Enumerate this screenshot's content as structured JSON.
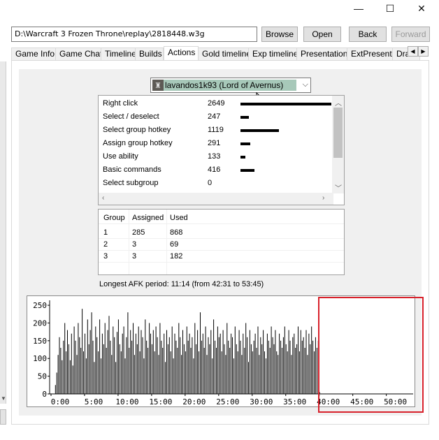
{
  "window_controls": {
    "minimize": "—",
    "maximize": "☐",
    "close": "✕"
  },
  "toolbar": {
    "path": "D:\\Warcraft 3 Frozen Throne\\replay\\2818448.w3g",
    "browse_label": "Browse",
    "open_label": "Open",
    "back_label": "Back",
    "forward_label": "Forward"
  },
  "tabs": [
    {
      "label": "Game Info"
    },
    {
      "label": "Game Chat"
    },
    {
      "label": "Timeline"
    },
    {
      "label": "Builds"
    },
    {
      "label": "Actions",
      "active": true
    },
    {
      "label": "Gold timeline"
    },
    {
      "label": "Exp timeline"
    },
    {
      "label": "Presentation"
    },
    {
      "label": "ExtPresent"
    },
    {
      "label": "Dra"
    }
  ],
  "player_select": {
    "value": "lavandos1k93 (Lord of Avernus)"
  },
  "actions": {
    "rows": [
      {
        "name": "Right click",
        "count": 2649
      },
      {
        "name": "Select / deselect",
        "count": 247
      },
      {
        "name": "Select group hotkey",
        "count": 1119
      },
      {
        "name": "Assign group hotkey",
        "count": 291
      },
      {
        "name": "Use ability",
        "count": 133
      },
      {
        "name": "Basic commands",
        "count": 416
      },
      {
        "name": "Select subgroup",
        "count": 0
      }
    ]
  },
  "groups": {
    "headers": [
      "Group",
      "Assigned",
      "Used"
    ],
    "rows": [
      [
        "1",
        "285",
        "868"
      ],
      [
        "2",
        "3",
        "69"
      ],
      [
        "3",
        "3",
        "182"
      ]
    ]
  },
  "afk": {
    "text": "Longest AFK period: 11:14 (from 42:31 to 53:45)"
  },
  "chart_data": {
    "type": "bar",
    "title": "",
    "xlabel": "",
    "ylabel": "",
    "ylim": [
      0,
      260
    ],
    "yticks": [
      0,
      50,
      100,
      150,
      200,
      250
    ],
    "xticks": [
      "0:00",
      "5:00",
      "10:00",
      "15:00",
      "20:00",
      "25:00",
      "30:00",
      "35:00",
      "40:00",
      "45:00",
      "50:00"
    ],
    "xlim_minutes": [
      0,
      54
    ],
    "bar_color": "#000000",
    "x_minutes": [
      0.0,
      0.2,
      0.4,
      0.6,
      0.8,
      1.0,
      1.2,
      1.4,
      1.6,
      1.8,
      2.0,
      2.2,
      2.4,
      2.6,
      2.8,
      3.0,
      3.2,
      3.4,
      3.6,
      3.8,
      4.0,
      4.2,
      4.4,
      4.6,
      4.8,
      5.0,
      5.2,
      5.4,
      5.6,
      5.8,
      6.0,
      6.2,
      6.4,
      6.6,
      6.8,
      7.0,
      7.2,
      7.4,
      7.6,
      7.8,
      8.0,
      8.2,
      8.4,
      8.6,
      8.8,
      9.0,
      9.2,
      9.4,
      9.6,
      9.8,
      10.0,
      10.2,
      10.4,
      10.6,
      10.8,
      11.0,
      11.2,
      11.4,
      11.6,
      11.8,
      12.0,
      12.2,
      12.4,
      12.6,
      12.8,
      13.0,
      13.2,
      13.4,
      13.6,
      13.8,
      14.0,
      14.2,
      14.4,
      14.6,
      14.8,
      15.0,
      15.2,
      15.4,
      15.6,
      15.8,
      16.0,
      16.2,
      16.4,
      16.6,
      16.8,
      17.0,
      17.2,
      17.4,
      17.6,
      17.8,
      18.0,
      18.2,
      18.4,
      18.6,
      18.8,
      19.0,
      19.2,
      19.4,
      19.6,
      19.8,
      20.0,
      20.2,
      20.4,
      20.6,
      20.8,
      21.0,
      21.2,
      21.4,
      21.6,
      21.8,
      22.0,
      22.2,
      22.4,
      22.6,
      22.8,
      23.0,
      23.2,
      23.4,
      23.6,
      23.8,
      24.0,
      24.2,
      24.4,
      24.6,
      24.8,
      25.0,
      25.2,
      25.4,
      25.6,
      25.8,
      26.0,
      26.2,
      26.4,
      26.6,
      26.8,
      27.0,
      27.2,
      27.4,
      27.6,
      27.8,
      28.0,
      28.2,
      28.4,
      28.6,
      28.8,
      29.0,
      29.2,
      29.4,
      29.6,
      29.8,
      30.0,
      30.2,
      30.4,
      30.6,
      30.8,
      31.0,
      31.2,
      31.4,
      31.6,
      31.8,
      32.0,
      32.2,
      32.4,
      32.6,
      32.8,
      33.0,
      33.2,
      33.4,
      33.6,
      33.8,
      34.0,
      34.2,
      34.4,
      34.6,
      34.8,
      35.0,
      35.2,
      35.4,
      35.6,
      35.8,
      36.0,
      36.2,
      36.4,
      36.6,
      36.8,
      37.0,
      37.2,
      37.4,
      37.6,
      37.8,
      38.0,
      38.2,
      38.4,
      38.6,
      38.8,
      39.0,
      39.2,
      39.4,
      39.6,
      39.8,
      40.0,
      40.2,
      40.4,
      40.6,
      40.8,
      41.0,
      41.2,
      41.4,
      41.6,
      41.8,
      42.0,
      42.2,
      42.4,
      43.0
    ],
    "values": [
      0,
      0,
      0,
      25,
      60,
      110,
      160,
      130,
      95,
      150,
      200,
      120,
      180,
      140,
      95,
      170,
      80,
      190,
      150,
      110,
      200,
      160,
      130,
      240,
      120,
      170,
      100,
      210,
      140,
      180,
      230,
      150,
      90,
      190,
      160,
      120,
      210,
      100,
      170,
      140,
      200,
      130,
      180,
      220,
      150,
      110,
      190,
      160,
      90,
      175,
      210,
      140,
      120,
      170,
      190,
      100,
      160,
      230,
      130,
      180,
      150,
      200,
      110,
      170,
      140,
      190,
      120,
      180,
      160,
      100,
      210,
      150,
      130,
      200,
      170,
      140,
      180,
      120,
      190,
      160,
      110,
      200,
      150,
      130,
      170,
      90,
      180,
      140,
      160,
      120,
      190,
      100,
      170,
      150,
      130,
      200,
      160,
      110,
      180,
      140,
      120,
      190,
      150,
      170,
      130,
      160,
      100,
      200,
      140,
      180,
      120,
      230,
      150,
      170,
      130,
      190,
      110,
      160,
      140,
      180,
      100,
      210,
      150,
      130,
      190,
      160,
      170,
      120,
      180,
      140,
      110,
      200,
      150,
      130,
      170,
      160,
      100,
      190,
      140,
      120,
      180,
      150,
      110,
      170,
      130,
      200,
      160,
      90,
      180,
      140,
      120,
      150,
      170,
      130,
      190,
      110,
      160,
      140,
      180,
      120,
      100,
      170,
      150,
      130,
      190,
      160,
      140,
      180,
      120,
      110,
      170,
      150,
      130,
      160,
      190,
      140,
      120,
      180,
      150,
      110,
      160,
      170,
      130,
      140,
      190,
      120,
      180,
      150,
      160,
      130,
      180,
      110,
      170,
      140,
      190,
      150,
      120,
      160,
      130,
      150,
      5
    ]
  }
}
